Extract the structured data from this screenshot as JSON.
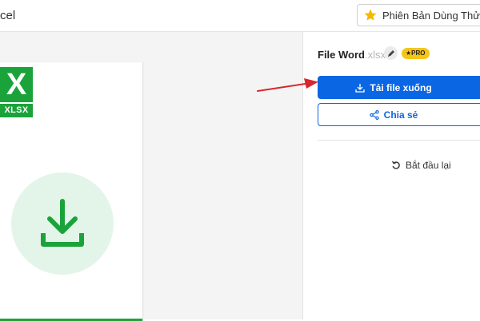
{
  "header": {
    "app_title": "cel",
    "trial_label": "Phiên Bản Dùng Thử Miễn Phí",
    "star_icon": "star-icon",
    "star_color": "#f5b800"
  },
  "preview": {
    "logo_letter": "X",
    "file_type": "XLSX",
    "brand_color": "#1aa33a",
    "icon": "download-arrow-icon"
  },
  "panel": {
    "file_name": "File Word",
    "file_ext": ".xlsx",
    "pro_badge": "★PRO",
    "download_label": "Tải file xuống",
    "share_label": "Chia sẻ",
    "restart_label": "Bắt đầu lại",
    "accent_color": "#0b66e4"
  },
  "annotation": {
    "arrow_color": "#d9262c"
  }
}
